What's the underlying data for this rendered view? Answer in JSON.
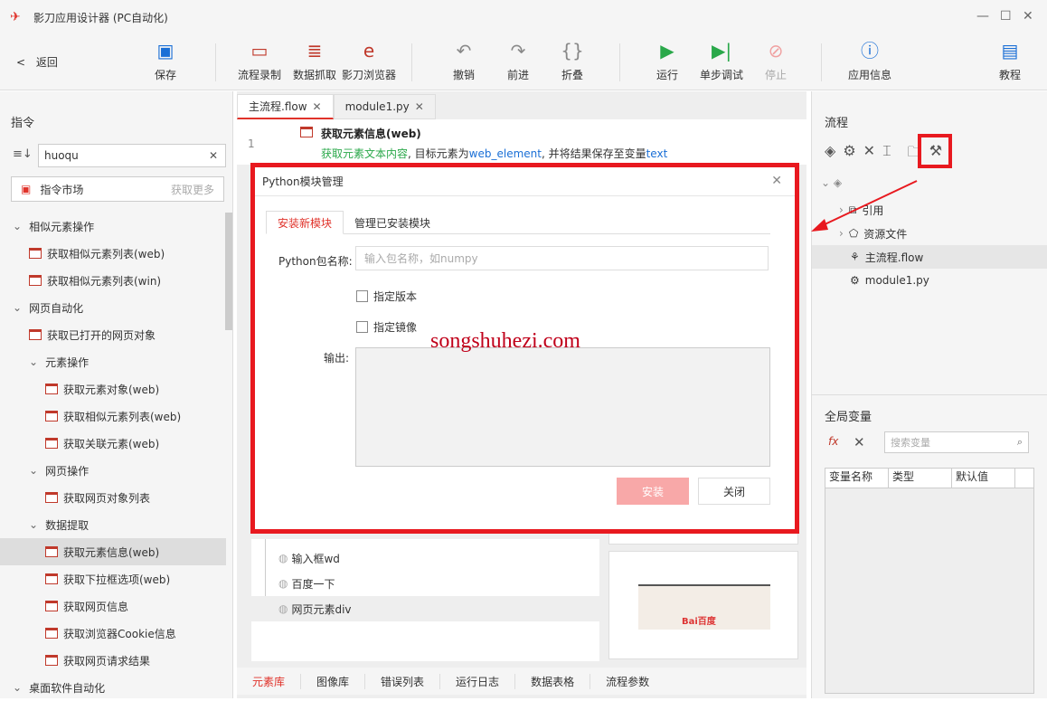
{
  "window": {
    "title": "影刀应用设计器 (PC自动化)"
  },
  "toolbar": {
    "back": "返回",
    "save": "保存",
    "record": "流程录制",
    "extract": "数据抓取",
    "browser": "影刀浏览器",
    "undo": "撤销",
    "redo": "前进",
    "fold": "折叠",
    "run": "运行",
    "step": "单步调试",
    "stop": "停止",
    "appinfo": "应用信息",
    "tutorial": "教程"
  },
  "left": {
    "title": "指令",
    "search_value": "huoqu",
    "market": "指令市场",
    "get_more": "获取更多",
    "items": [
      {
        "label": "相似元素操作",
        "type": "group"
      },
      {
        "label": "获取相似元素列表(web)",
        "type": "item"
      },
      {
        "label": "获取相似元素列表(win)",
        "type": "item"
      },
      {
        "label": "网页自动化",
        "type": "group"
      },
      {
        "label": "获取已打开的网页对象",
        "type": "item"
      },
      {
        "label": "元素操作",
        "type": "subgroup"
      },
      {
        "label": "获取元素对象(web)",
        "type": "subitem"
      },
      {
        "label": "获取相似元素列表(web)",
        "type": "subitem"
      },
      {
        "label": "获取关联元素(web)",
        "type": "subitem"
      },
      {
        "label": "网页操作",
        "type": "subgroup"
      },
      {
        "label": "获取网页对象列表",
        "type": "subitem"
      },
      {
        "label": "数据提取",
        "type": "subgroup"
      },
      {
        "label": "获取元素信息(web)",
        "type": "subitem",
        "selected": true
      },
      {
        "label": "获取下拉框选项(web)",
        "type": "subitem"
      },
      {
        "label": "获取网页信息",
        "type": "subitem"
      },
      {
        "label": "获取浏览器Cookie信息",
        "type": "subitem"
      },
      {
        "label": "获取网页请求结果",
        "type": "subitem"
      },
      {
        "label": "桌面软件自动化",
        "type": "group"
      }
    ]
  },
  "center": {
    "tabs": [
      "主流程.flow",
      "module1.py"
    ],
    "line_number": "1",
    "step_title": "获取元素信息(web)",
    "step_desc_a": "获取元素文本内容",
    "step_desc_b": ", 目标元素为",
    "step_desc_var": "web_element",
    "step_desc_c": ", 并将结果保存至变量",
    "step_desc_out": "text",
    "elements": [
      "输入框wd",
      "百度一下",
      "网页元素div"
    ],
    "bottom_tabs": [
      "元素库",
      "图像库",
      "错误列表",
      "运行日志",
      "数据表格",
      "流程参数"
    ]
  },
  "right": {
    "flow_title": "流程",
    "tree": [
      "引用",
      "资源文件",
      "主流程.flow",
      "module1.py"
    ],
    "globals_title": "全局变量",
    "search_placeholder": "搜索变量",
    "columns": [
      "变量名称",
      "类型",
      "默认值"
    ]
  },
  "modal": {
    "title": "Python模块管理",
    "tabs": [
      "安装新模块",
      "管理已安装模块"
    ],
    "pkg_label": "Python包名称:",
    "pkg_placeholder": "输入包名称，如numpy",
    "chk_version": "指定版本",
    "chk_mirror": "指定镜像",
    "output_label": "输出:",
    "install": "安装",
    "close": "关闭"
  },
  "watermark": "songshuhezi.com",
  "colors": {
    "accent": "#e0322a",
    "highlight": "#e8191f",
    "run_green": "#2aa84a",
    "link_blue": "#1a6fd6"
  }
}
